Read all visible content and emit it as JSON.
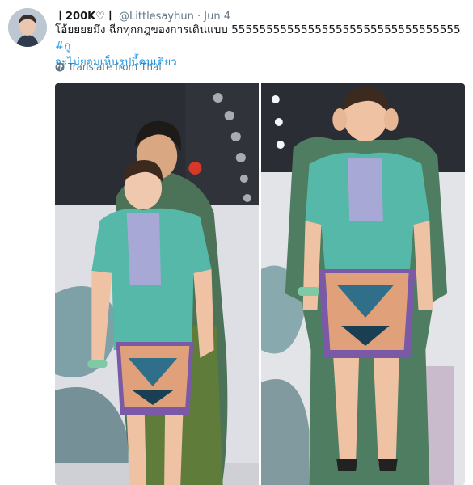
{
  "tweet": {
    "display_name": "丨200K♡丨",
    "handle": "@Littlesayhun",
    "separator": "·",
    "date": "Jun 4",
    "text_line1": "โอ้ยยยยมึง ฉีกทุกกฎของการเดินแบบ 555555555555555555555555555555555",
    "hashtag_a": "#กู",
    "hashtag_b": "จะไม่ยอมเห็นรูปนี้คนเดียว",
    "translate_label": "Translate from Thai"
  },
  "colors": {
    "link": "#1b95e0",
    "meta": "#657786",
    "text": "#14171a"
  },
  "icons": {
    "translate": "globe-icon"
  }
}
